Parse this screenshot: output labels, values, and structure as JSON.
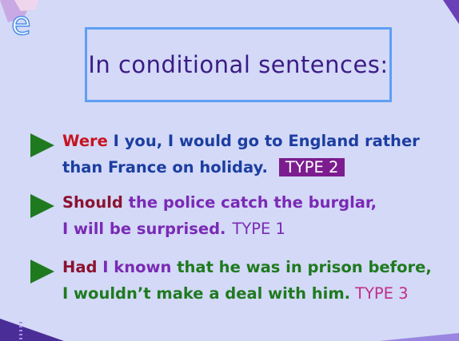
{
  "logo_letter": "e",
  "title": "In conditional sentences:",
  "items": [
    {
      "line1": [
        {
          "text": "Were",
          "cls": "red"
        },
        {
          "text": " I you, I would go to England rather",
          "cls": "blue"
        }
      ],
      "line2": [
        {
          "text": "than France on holiday.",
          "cls": "blue"
        }
      ],
      "tag": "TYPE 2"
    },
    {
      "line1": [
        {
          "text": "Should",
          "cls": "maroon"
        },
        {
          "text": " the police catch the burglar,",
          "cls": "purple"
        }
      ],
      "line2": [
        {
          "text": "I will be surprised.",
          "cls": "purple"
        }
      ],
      "tag": "TYPE 1"
    },
    {
      "line1": [
        {
          "text": "Had",
          "cls": "maroon"
        },
        {
          "text": " I known",
          "cls": "purple"
        },
        {
          "text": " that he was in prison before,",
          "cls": "green"
        }
      ],
      "line2": [
        {
          "text": "I wouldn’t make a deal with him.",
          "cls": "green"
        }
      ],
      "tag": "TYPE 3"
    }
  ],
  "colors": {
    "background": "#d3d9f7",
    "title_border": "#5f9ff3",
    "arrow": "#1f7a1f"
  }
}
